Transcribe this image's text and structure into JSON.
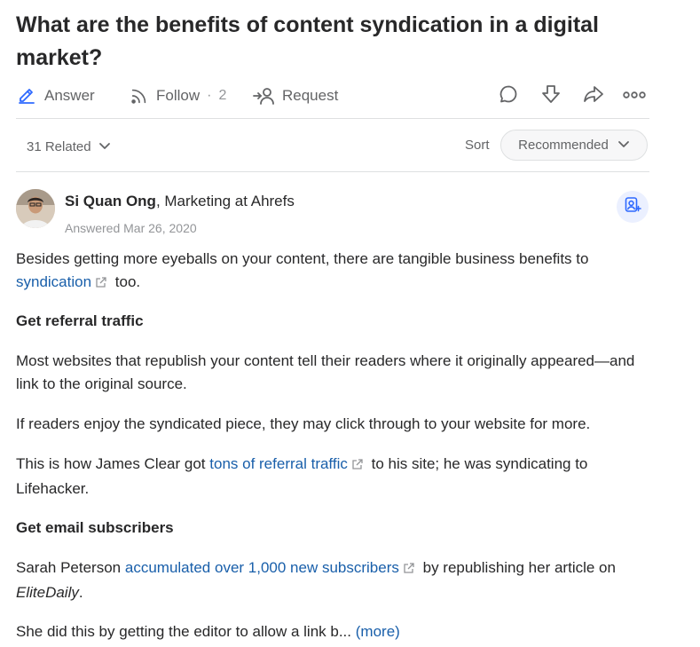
{
  "question": {
    "title": "What are the benefits of content syndication in a digital market?"
  },
  "actions": {
    "answer_label": "Answer",
    "follow_label": "Follow",
    "follow_sep": "·",
    "follow_count": "2",
    "request_label": "Request",
    "icons": [
      "comment-icon",
      "downvote-icon",
      "share-icon",
      "more-icon"
    ]
  },
  "related": {
    "label": "31 Related"
  },
  "sort": {
    "label": "Sort",
    "value": "Recommended"
  },
  "answer": {
    "author_name": "Si Quan Ong",
    "author_credential": ", Marketing at Ahrefs",
    "answered_date": "Answered Mar 26, 2020",
    "paragraphs": {
      "p1_text": "Besides getting more eyeballs on your content, there are tangible business benefits to",
      "p1_link": "syndication",
      "p1_tail": "too.",
      "h1": "Get referral traffic",
      "p2": "Most websites that republish your content tell their readers where it originally appeared—and link to the original source.",
      "p3": "If readers enjoy the syndicated piece, they may click through to your website for more.",
      "p4_text": "This is how James Clear got",
      "p4_link": "tons of referral traffic",
      "p4_tail": "to his site; he was syndicating to Lifehacker.",
      "h2": "Get email subscribers",
      "p5_text": "Sarah Peterson",
      "p5_link": "accumulated over 1,000 new subscribers",
      "p5_tail": "by republishing her article on",
      "p5_italic": "EliteDaily",
      "p5_end": ".",
      "p6_text": "She did this by getting the editor to allow a link b...",
      "p6_more": "(more)"
    }
  },
  "colors": {
    "accent": "#2e69ff",
    "link": "#195faa",
    "text": "#282829",
    "muted": "#636466"
  }
}
